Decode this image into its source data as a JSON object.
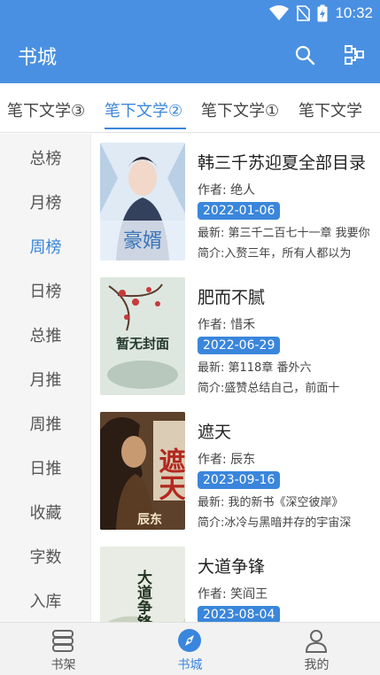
{
  "status_bar": {
    "time": "10:32",
    "icons": [
      "wifi-icon",
      "no-sim-icon",
      "battery-charging-icon"
    ]
  },
  "app_bar": {
    "title": "书城",
    "actions": [
      "search-icon",
      "share-icon"
    ]
  },
  "tabs": [
    {
      "label": "笔下文学③",
      "active": false
    },
    {
      "label": "笔下文学②",
      "active": true
    },
    {
      "label": "笔下文学①",
      "active": false
    },
    {
      "label": "笔下文学",
      "active": false
    }
  ],
  "ranks": [
    {
      "label": "总榜"
    },
    {
      "label": "月榜"
    },
    {
      "label": "周榜",
      "active": true
    },
    {
      "label": "日榜"
    },
    {
      "label": "总推"
    },
    {
      "label": "月推"
    },
    {
      "label": "周推"
    },
    {
      "label": "日推"
    },
    {
      "label": "收藏"
    },
    {
      "label": "字数"
    },
    {
      "label": "入库"
    }
  ],
  "books": [
    {
      "title": "韩三千苏迎夏全部目录",
      "author": "作者: 绝人",
      "date": "2022-01-06",
      "latest": "最新: 第三千二百七十一章 我要你",
      "intro": "简介:入赘三年，所有人都以为",
      "cover_text": "豪婿"
    },
    {
      "title": "肥而不腻",
      "author": "作者: 惜禾",
      "date": "2022-06-29",
      "latest": "最新: 第118章 番外六",
      "intro": "简介:盛赞总结自己，前面十",
      "cover_text": "暂无封面"
    },
    {
      "title": "遮天",
      "author": "作者: 辰东",
      "date": "2023-09-16",
      "latest": "最新: 我的新书《深空彼岸》",
      "intro": "简介:冰冷与黑暗并存的宇宙深",
      "cover_text": "遮天",
      "cover_author": "辰东"
    },
    {
      "title": "大道争锋",
      "author": "作者: 笑阎王",
      "date": "2023-08-04",
      "latest": "",
      "intro": "",
      "cover_text": "大道争锋"
    }
  ],
  "bottom_nav": [
    {
      "label": "书架",
      "icon": "bookshelf-icon",
      "active": false
    },
    {
      "label": "书城",
      "icon": "compass-icon",
      "active": true
    },
    {
      "label": "我的",
      "icon": "person-icon",
      "active": false
    }
  ],
  "colors": {
    "primary": "#4a90e2",
    "accent": "#3a86dc"
  }
}
